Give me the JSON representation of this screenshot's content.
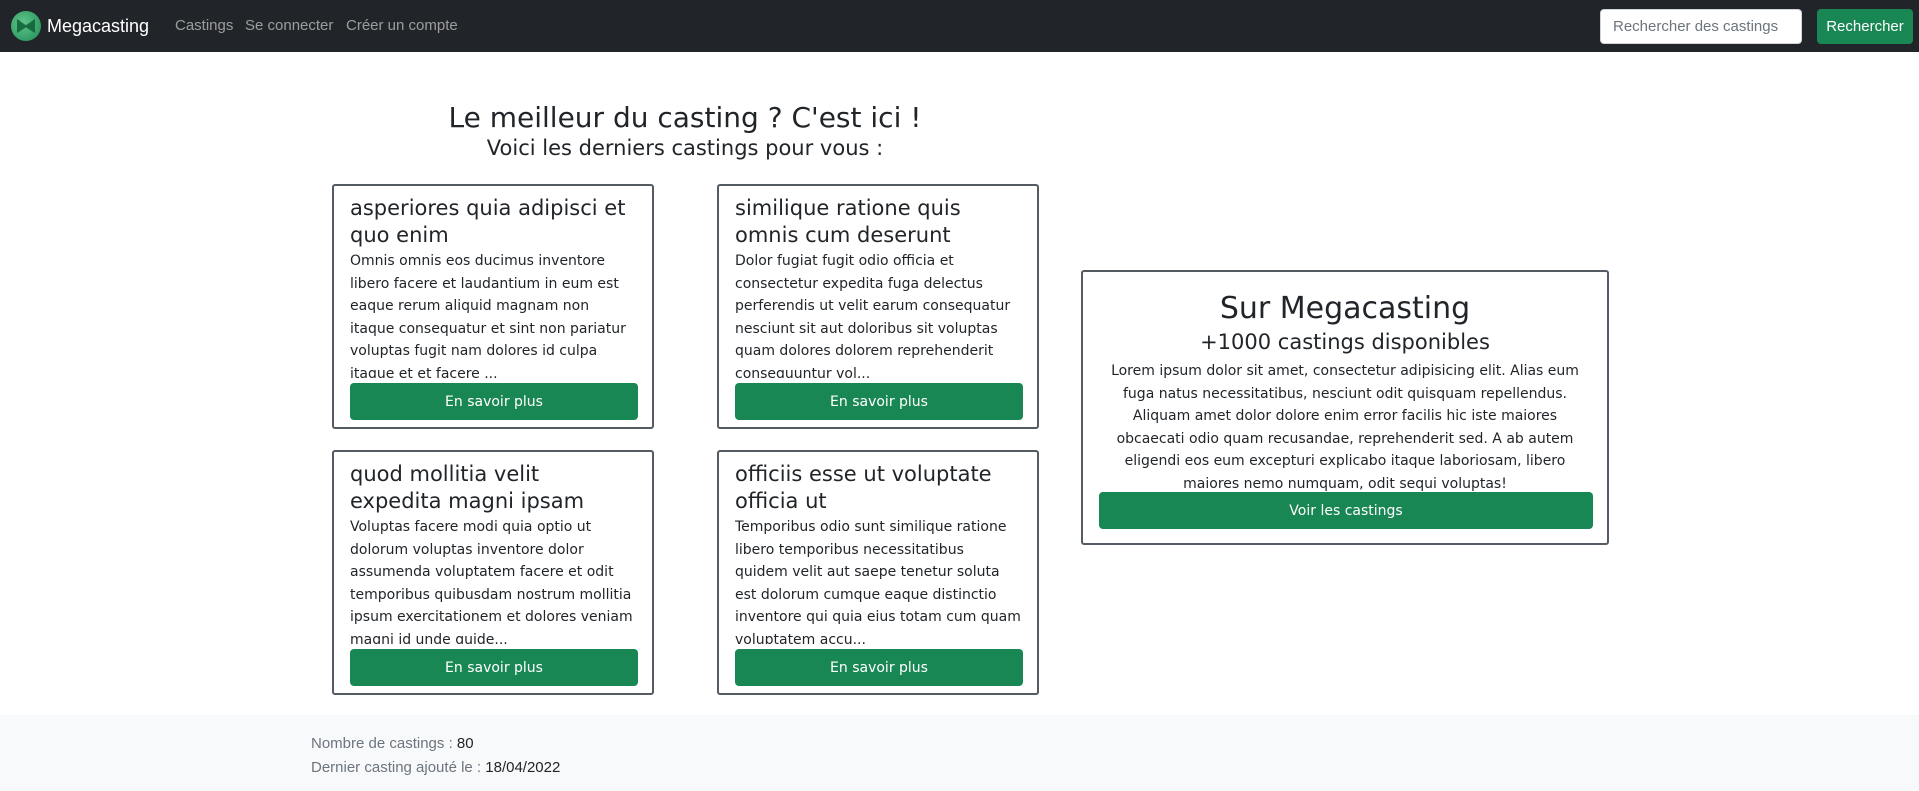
{
  "navbar": {
    "brand": "Megacasting",
    "links": [
      "Castings",
      "Se connecter",
      "Créer un compte"
    ],
    "search": {
      "placeholder": "Rechercher des castings",
      "value": ""
    },
    "search_button": "Rechercher"
  },
  "hero": {
    "title": "Le meilleur du casting ? C'est ici !",
    "subtitle": "Voici les derniers castings pour vous :"
  },
  "castings": [
    {
      "title": "asperiores quia adipisci et quo enim",
      "text": "Omnis omnis eos ducimus inventore libero facere et laudantium in eum est eaque rerum aliquid magnam non itaque consequatur et sint non pariatur voluptas fugit nam dolores id culpa itaque et et facere ...",
      "button": "En savoir plus"
    },
    {
      "title": "similique ratione quis omnis cum deserunt",
      "text": "Dolor fugiat fugit odio officia et consectetur expedita fuga delectus perferendis ut velit earum consequatur nesciunt sit aut doloribus sit voluptas quam dolores dolorem reprehenderit consequuntur vol...",
      "button": "En savoir plus"
    },
    {
      "title": "quod mollitia velit expedita magni ipsam",
      "text": "Voluptas facere modi quia optio ut dolorum voluptas inventore dolor assumenda voluptatem facere et odit temporibus quibusdam nostrum mollitia ipsum exercitationem et dolores veniam magni id unde quide...",
      "button": "En savoir plus"
    },
    {
      "title": "officiis esse ut voluptate officia ut",
      "text": "Temporibus odio sunt similique ratione libero temporibus necessitatibus quidem velit aut saepe tenetur soluta est dolorum cumque eaque distinctio inventore qui quia eius totam cum quam voluptatem accu...",
      "button": "En savoir plus"
    }
  ],
  "info": {
    "title": "Sur Megacasting",
    "subtitle": "+1000 castings disponibles",
    "text": "Lorem ipsum dolor sit amet, consectetur adipisicing elit. Alias eum fuga natus necessitatibus, nesciunt odit quisquam repellendus. Aliquam amet dolor dolore enim error facilis hic iste maiores obcaecati odio quam recusandae, reprehenderit sed. A ab autem eligendi eos eum excepturi explicabo itaque laboriosam, libero maiores nemo numquam, odit sequi voluptas!",
    "button": "Voir les castings"
  },
  "footer": {
    "count_label": "Nombre de castings : ",
    "count_value": "80",
    "last_label": "Dernier casting ajouté le : ",
    "last_value": "18/04/2022"
  }
}
